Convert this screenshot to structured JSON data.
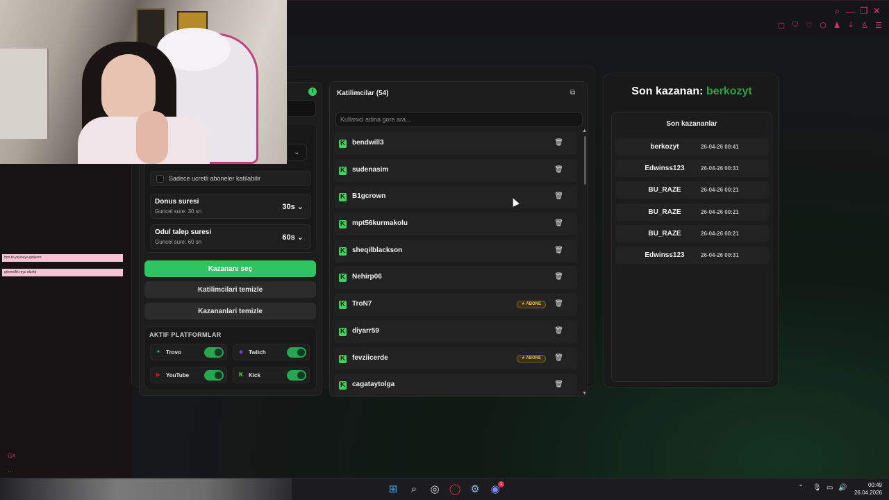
{
  "browser": {
    "window_controls": [
      "⌕",
      "—",
      "❐",
      "✕"
    ],
    "tools": [
      "▢",
      "⛉",
      "♡",
      "⬡",
      "♟",
      "⤓",
      "♙",
      "☰"
    ]
  },
  "overlay_chat": [
    "bon bi yayinuya gidiyore",
    "görmedik reyc oluritti"
  ],
  "sidebar": {
    "gx": "GX",
    "more": "..."
  },
  "settings": {
    "badge": "!",
    "dropdown_chevron": "⌄",
    "checkbox_label": "Sadece ucretli aboneler katilabilir",
    "rows": [
      {
        "title": "Donus suresi",
        "sub": "Guncel sure: 30 sn",
        "value": "30s"
      },
      {
        "title": "Odul talep suresi",
        "sub": "Guncel sure: 60 sn",
        "value": "60s"
      }
    ],
    "pick_winner": "Kazananı seç",
    "clear_participants": "Katilimcilari temizle",
    "clear_winners": "Kazananlari temizle",
    "platforms_title": "AKTIF PLATFORMLAR",
    "platforms": [
      {
        "name": "Trovo",
        "icon": "✦",
        "color": "#1fbf83"
      },
      {
        "name": "Twitch",
        "icon": "◈",
        "color": "#9146ff"
      },
      {
        "name": "YouTube",
        "icon": "▶",
        "color": "#ff0000"
      },
      {
        "name": "Kick",
        "icon": "K",
        "color": "#53fc18"
      }
    ]
  },
  "participants": {
    "title": "Katilimcilar (54)",
    "search_placeholder": "Kullanici adina gore ara...",
    "items": [
      {
        "name": "bendwill3",
        "badge": ""
      },
      {
        "name": "sudenasim",
        "badge": ""
      },
      {
        "name": "B1gcrown",
        "badge": ""
      },
      {
        "name": "mpt56kurmakolu",
        "badge": ""
      },
      {
        "name": "sheqilblackson",
        "badge": ""
      },
      {
        "name": "Nehirp06",
        "badge": ""
      },
      {
        "name": "TroN7",
        "badge": "★ ABONE"
      },
      {
        "name": "diyarr59",
        "badge": ""
      },
      {
        "name": "fevziicerde",
        "badge": "★ ABONE"
      },
      {
        "name": "cagataytolga",
        "badge": ""
      }
    ]
  },
  "winners": {
    "title_prefix": "Son kazanan:",
    "title_name": "berkozyt",
    "list_title": "Son kazananlar",
    "items": [
      {
        "name": "berkozyt",
        "date": "26-04-26 00:41"
      },
      {
        "name": "Edwinss123",
        "date": "26-04-26 00:31"
      },
      {
        "name": "BU_RAZE",
        "date": "26-04-26 00:21"
      },
      {
        "name": "BU_RAZE",
        "date": "26-04-26 00:21"
      },
      {
        "name": "BU_RAZE",
        "date": "26-04-26 00:21"
      },
      {
        "name": "Edwinss123",
        "date": "26-04-26 00:31"
      }
    ]
  },
  "taskbar": {
    "time": "00:49",
    "date": "26.04.2026",
    "discord_badge": "1"
  }
}
